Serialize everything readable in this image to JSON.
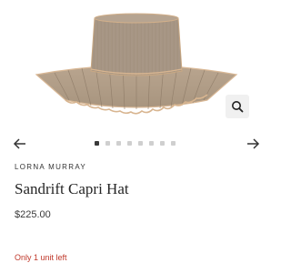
{
  "product": {
    "image_alt": "Sandrift Capri Hat",
    "brand": "LORNA MURRAY",
    "title": "Sandrift Capri Hat",
    "price": "$225.00",
    "stock_note": "Only 1 unit left"
  },
  "gallery": {
    "slide_count": 8,
    "active_index": 0
  },
  "icons": {
    "zoom": "search-icon",
    "prev": "arrow-left-icon",
    "next": "arrow-right-icon"
  },
  "colors": {
    "stock_note": "#c0392b",
    "hat_straw": "#c4a98c"
  }
}
